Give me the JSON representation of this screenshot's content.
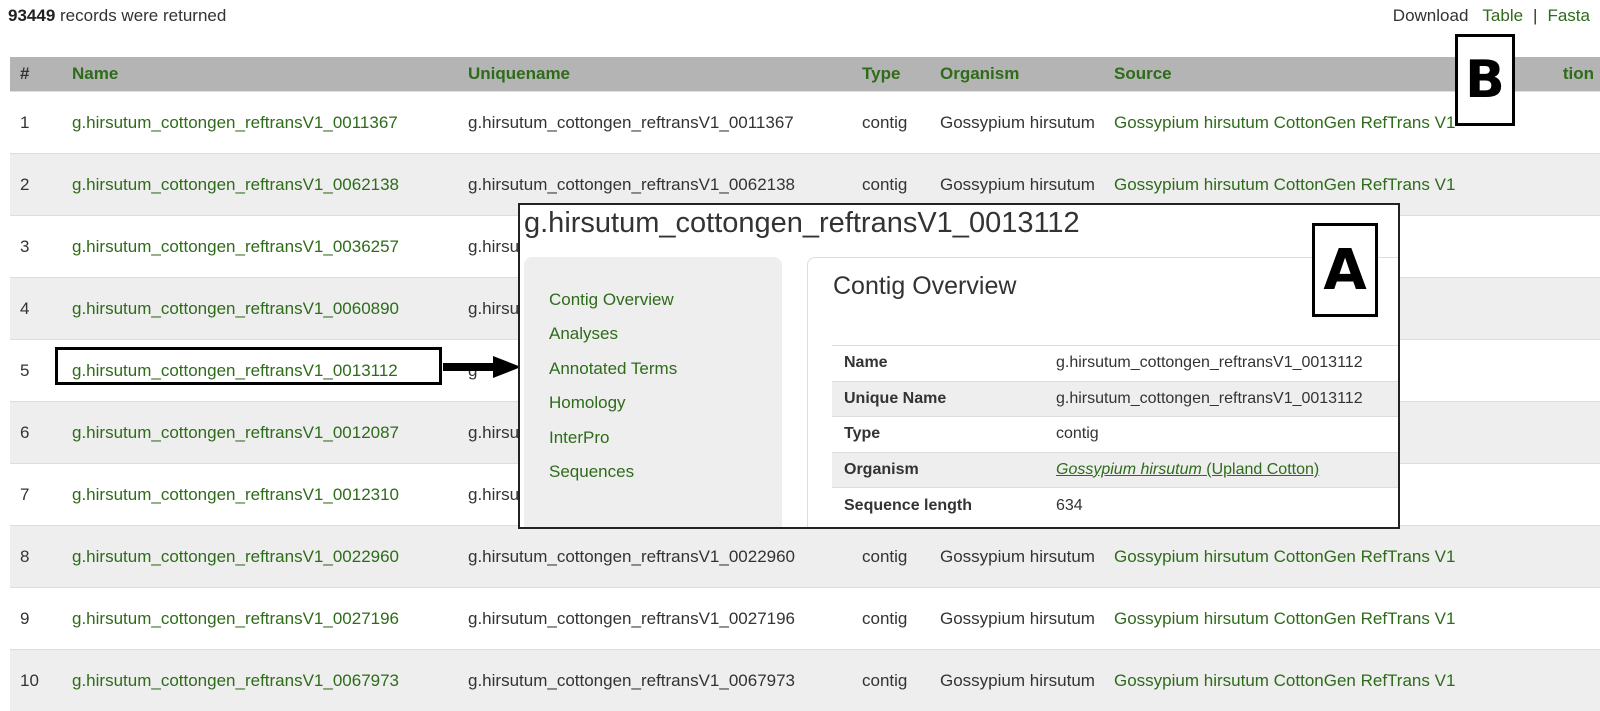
{
  "header": {
    "count_number": "93449",
    "count_text": " records were returned",
    "download_label": "Download",
    "table_link": "Table",
    "separator": "|",
    "fasta_link": "Fasta"
  },
  "table": {
    "columns": [
      "#",
      "Name",
      "Uniquename",
      "Type",
      "Organism",
      "Source",
      "tion"
    ],
    "rows": [
      {
        "num": "1",
        "name": "g.hirsutum_cottongen_reftransV1_0011367",
        "uniquename": "g.hirsutum_cottongen_reftransV1_0011367",
        "type": "contig",
        "organism": "Gossypium hirsutum",
        "source": "Gossypium hirsutum CottonGen RefTrans V1"
      },
      {
        "num": "2",
        "name": "g.hirsutum_cottongen_reftransV1_0062138",
        "uniquename": "g.hirsutum_cottongen_reftransV1_0062138",
        "type": "contig",
        "organism": "Gossypium hirsutum",
        "source": "Gossypium hirsutum CottonGen RefTrans V1"
      },
      {
        "num": "3",
        "name": "g.hirsutum_cottongen_reftransV1_0036257",
        "uniquename": "g.hirsu",
        "type": "",
        "organism": "",
        "source": ""
      },
      {
        "num": "4",
        "name": "g.hirsutum_cottongen_reftransV1_0060890",
        "uniquename": "g.hirsu",
        "type": "",
        "organism": "",
        "source": ""
      },
      {
        "num": "5",
        "name": "g.hirsutum_cottongen_reftransV1_0013112",
        "uniquename": "g",
        "type": "",
        "organism": "",
        "source": ""
      },
      {
        "num": "6",
        "name": "g.hirsutum_cottongen_reftransV1_0012087",
        "uniquename": "g.hirsu",
        "type": "",
        "organism": "",
        "source": ""
      },
      {
        "num": "7",
        "name": "g.hirsutum_cottongen_reftransV1_0012310",
        "uniquename": "g.hirsu",
        "type": "",
        "organism": "",
        "source": ""
      },
      {
        "num": "8",
        "name": "g.hirsutum_cottongen_reftransV1_0022960",
        "uniquename": "g.hirsutum_cottongen_reftransV1_0022960",
        "type": "contig",
        "organism": "Gossypium hirsutum",
        "source": "Gossypium hirsutum CottonGen RefTrans V1"
      },
      {
        "num": "9",
        "name": "g.hirsutum_cottongen_reftransV1_0027196",
        "uniquename": "g.hirsutum_cottongen_reftransV1_0027196",
        "type": "contig",
        "organism": "Gossypium hirsutum",
        "source": "Gossypium hirsutum CottonGen RefTrans V1"
      },
      {
        "num": "10",
        "name": "g.hirsutum_cottongen_reftransV1_0067973",
        "uniquename": "g.hirsutum_cottongen_reftransV1_0067973",
        "type": "contig",
        "organism": "Gossypium hirsutum",
        "source": "Gossypium hirsutum CottonGen RefTrans V1"
      }
    ]
  },
  "popup": {
    "title": "g.hirsutum_cottongen_reftransV1_0013112",
    "nav": [
      "Contig Overview",
      "Analyses",
      "Annotated Terms",
      "Homology",
      "InterPro",
      "Sequences"
    ],
    "content_title": "Contig Overview",
    "overview": {
      "name_label": "Name",
      "name_value": "g.hirsutum_cottongen_reftransV1_0013112",
      "unique_label": "Unique Name",
      "unique_value": "g.hirsutum_cottongen_reftransV1_0013112",
      "type_label": "Type",
      "type_value": "contig",
      "organism_label": "Organism",
      "organism_species": "Gossypium hirsutum",
      "organism_common": " (Upland Cotton)",
      "length_label": "Sequence length",
      "length_value": "634"
    }
  },
  "annotations": {
    "label_a": "A",
    "label_b": "B"
  }
}
